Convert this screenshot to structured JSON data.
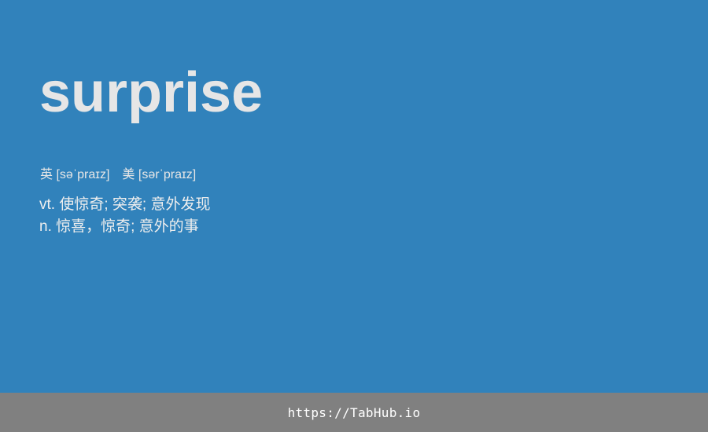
{
  "entry": {
    "word": "surprise",
    "phonetics": {
      "uk_label": "英",
      "uk": "[səˈpraɪz]",
      "us_label": "美",
      "us": "[sərˈpraɪz]"
    },
    "definitions": [
      "vt. 使惊奇; 突袭; 意外发现",
      "n. 惊喜，惊奇; 意外的事"
    ]
  },
  "footer": {
    "link": "https://TabHub.io"
  },
  "colors": {
    "background": "#3182bb",
    "footer": "#808080",
    "text": "#e6e6e6"
  }
}
